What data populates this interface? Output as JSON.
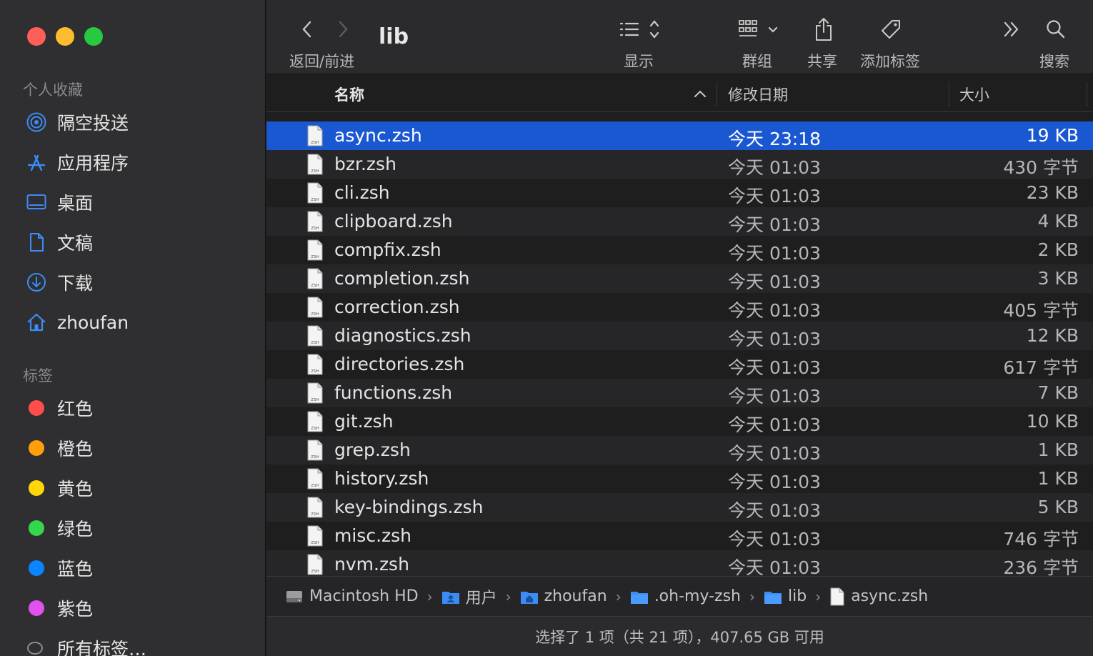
{
  "window": {
    "title": "lib",
    "traffic_colors": {
      "close": "#ff5f57",
      "minimize": "#febc2e",
      "maximize": "#28c840"
    }
  },
  "toolbar": {
    "nav_label": "返回/前进",
    "view_label": "显示",
    "group_label": "群组",
    "share_label": "共享",
    "tag_label": "添加标签",
    "search_label": "搜索"
  },
  "sidebar": {
    "favorites_title": "个人收藏",
    "favorites": [
      {
        "label": "隔空投送",
        "icon": "airdrop-icon"
      },
      {
        "label": "应用程序",
        "icon": "applications-icon"
      },
      {
        "label": "桌面",
        "icon": "desktop-icon"
      },
      {
        "label": "文稿",
        "icon": "document-icon"
      },
      {
        "label": "下载",
        "icon": "download-icon"
      },
      {
        "label": "zhoufan",
        "icon": "home-icon"
      }
    ],
    "tags_title": "标签",
    "tags": [
      {
        "label": "红色",
        "color": "#ff4d4d"
      },
      {
        "label": "橙色",
        "color": "#ff9f0a"
      },
      {
        "label": "黄色",
        "color": "#ffd60a"
      },
      {
        "label": "绿色",
        "color": "#32d74b"
      },
      {
        "label": "蓝色",
        "color": "#0a84ff"
      },
      {
        "label": "紫色",
        "color": "#e051f0"
      },
      {
        "label": "所有标签…",
        "color": ""
      }
    ],
    "accent": "#3b8cf5"
  },
  "columns": {
    "name": "名称",
    "date": "修改日期",
    "size": "大小"
  },
  "files": [
    {
      "name": "async.zsh",
      "date": "今天 23:18",
      "size": "19 KB",
      "selected": true
    },
    {
      "name": "bzr.zsh",
      "date": "今天 01:03",
      "size": "430 字节"
    },
    {
      "name": "cli.zsh",
      "date": "今天 01:03",
      "size": "23 KB"
    },
    {
      "name": "clipboard.zsh",
      "date": "今天 01:03",
      "size": "4 KB"
    },
    {
      "name": "compfix.zsh",
      "date": "今天 01:03",
      "size": "2 KB"
    },
    {
      "name": "completion.zsh",
      "date": "今天 01:03",
      "size": "3 KB"
    },
    {
      "name": "correction.zsh",
      "date": "今天 01:03",
      "size": "405 字节"
    },
    {
      "name": "diagnostics.zsh",
      "date": "今天 01:03",
      "size": "12 KB"
    },
    {
      "name": "directories.zsh",
      "date": "今天 01:03",
      "size": "617 字节"
    },
    {
      "name": "functions.zsh",
      "date": "今天 01:03",
      "size": "7 KB"
    },
    {
      "name": "git.zsh",
      "date": "今天 01:03",
      "size": "10 KB"
    },
    {
      "name": "grep.zsh",
      "date": "今天 01:03",
      "size": "1 KB"
    },
    {
      "name": "history.zsh",
      "date": "今天 01:03",
      "size": "1 KB"
    },
    {
      "name": "key-bindings.zsh",
      "date": "今天 01:03",
      "size": "5 KB"
    },
    {
      "name": "misc.zsh",
      "date": "今天 01:03",
      "size": "746 字节"
    },
    {
      "name": "nvm.zsh",
      "date": "今天 01:03",
      "size": "236 字节"
    }
  ],
  "file_icon_text": "ZSH",
  "path": [
    {
      "label": "Macintosh HD",
      "icon": "hard-drive-icon"
    },
    {
      "label": "用户",
      "icon": "users-folder-icon"
    },
    {
      "label": "zhoufan",
      "icon": "home-folder-icon"
    },
    {
      "label": ".oh-my-zsh",
      "icon": "folder-icon"
    },
    {
      "label": "lib",
      "icon": "folder-icon"
    },
    {
      "label": "async.zsh",
      "icon": "file-icon"
    }
  ],
  "status": "选择了 1 项（共 21 项），407.65 GB 可用"
}
